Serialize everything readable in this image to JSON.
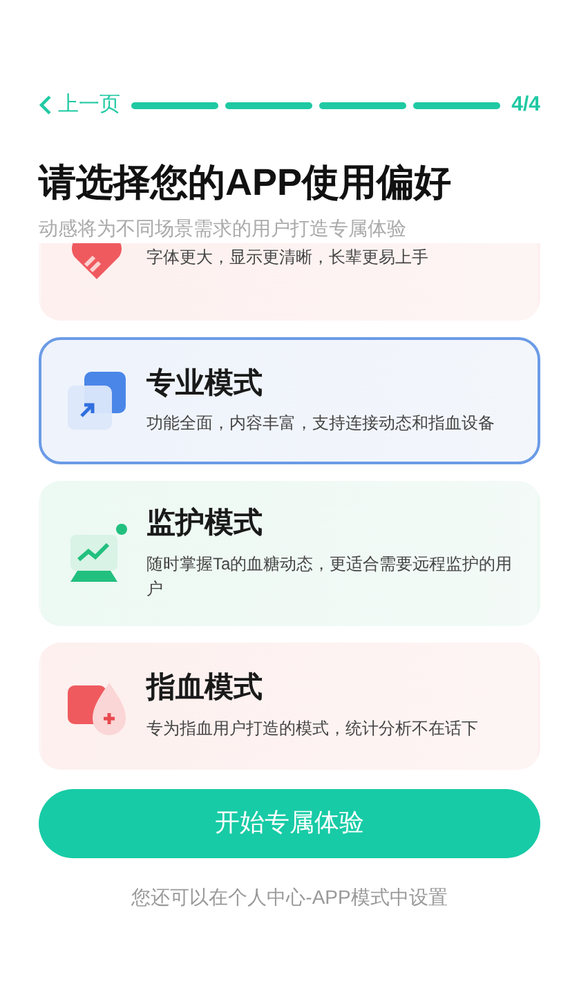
{
  "nav": {
    "back": "上一页",
    "page": "4/4",
    "steps": [
      {
        "done": true
      },
      {
        "done": true
      },
      {
        "done": true
      },
      {
        "done": true
      }
    ]
  },
  "title": "请选择您的APP使用偏好",
  "subtitle": "动感将为不同场景需求的用户打造专属体验",
  "modes": [
    {
      "kind": "large",
      "clipped": true,
      "selected": false,
      "description": "字体更大，显示更清晰，长辈更易上手"
    },
    {
      "kind": "pro",
      "clipped": false,
      "selected": true,
      "title": "专业模式",
      "description": "功能全面，内容丰富，支持连接动态和指血设备"
    },
    {
      "kind": "monitor",
      "clipped": false,
      "selected": false,
      "title": "监护模式",
      "description": "随时掌握Ta的血糖动态，更适合需要远程监护的用户"
    },
    {
      "kind": "finger",
      "clipped": false,
      "selected": false,
      "title": "指血模式",
      "description": "专为指血用户打造的模式，统计分析不在话下"
    }
  ],
  "start_button": "开始专属体验",
  "footer": "您还可以在个人中心-APP模式中设置"
}
